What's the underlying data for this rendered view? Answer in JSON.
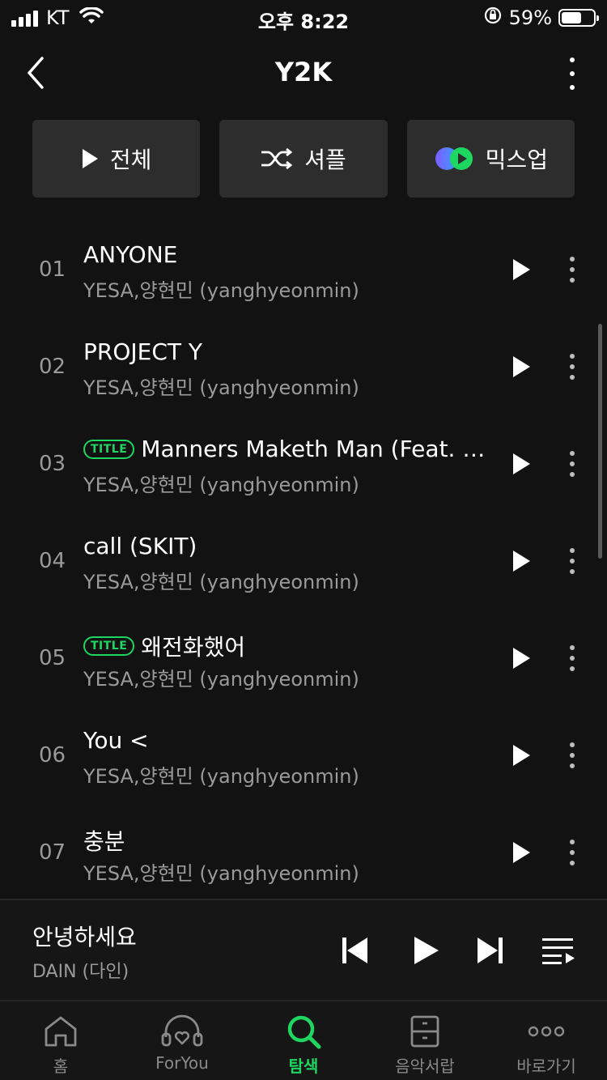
{
  "status_bar": {
    "carrier": "KT",
    "time": "오후 8:22",
    "battery": "59%"
  },
  "header": {
    "title": "Y2K"
  },
  "actions": {
    "play_all": "전체",
    "shuffle": "셔플",
    "mixup": "믹스업"
  },
  "tracks": [
    {
      "num": "01",
      "title": "ANYONE",
      "artist": "YESA,양현민 (yanghyeonmin)",
      "badge": ""
    },
    {
      "num": "02",
      "title": "PROJECT Y",
      "artist": "YESA,양현민 (yanghyeonmin)",
      "badge": ""
    },
    {
      "num": "03",
      "title": "Manners Maketh Man (Feat. Ri...",
      "artist": "YESA,양현민 (yanghyeonmin)",
      "badge": "TITLE"
    },
    {
      "num": "04",
      "title": "call (SKIT)",
      "artist": "YESA,양현민 (yanghyeonmin)",
      "badge": ""
    },
    {
      "num": "05",
      "title": "왜전화했어",
      "artist": "YESA,양현민 (yanghyeonmin)",
      "badge": "TITLE"
    },
    {
      "num": "06",
      "title": "You <",
      "artist": "YESA,양현민 (yanghyeonmin)",
      "badge": ""
    },
    {
      "num": "07",
      "title": "충분",
      "artist": "YESA,양현민 (yanghyeonmin)",
      "badge": ""
    }
  ],
  "mini_player": {
    "title": "안녕하세요",
    "artist": "DAIN (다인)"
  },
  "bottom_nav": [
    {
      "label": "홈",
      "icon": "home-icon",
      "active": false
    },
    {
      "label": "ForYou",
      "icon": "foryou-icon",
      "active": false
    },
    {
      "label": "탐색",
      "icon": "search-icon",
      "active": true
    },
    {
      "label": "음악서랍",
      "icon": "drawer-icon",
      "active": false
    },
    {
      "label": "바로가기",
      "icon": "shortcut-icon",
      "active": false
    }
  ],
  "colors": {
    "accent": "#1ed760",
    "background": "#121212",
    "button_bg": "#2d2d2d",
    "secondary_text": "#9a9a9a"
  }
}
